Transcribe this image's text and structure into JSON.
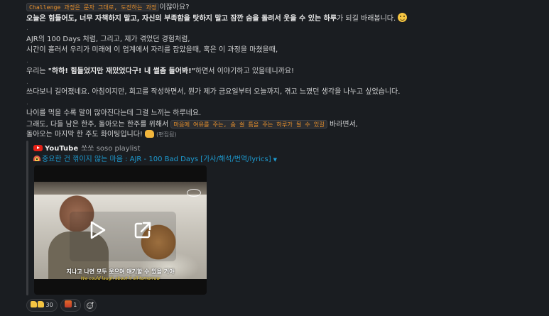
{
  "message": {
    "line1_code": "Challenge 과정은 문자 그대로, 도전하는 과정",
    "line1_rest": "이잖아요?",
    "line2_bold": "오늘은 힘들어도, 너무 자책하지 말고, 자신의 부족함을 탓하지 말고 잠깐 숨을 돌려서 웃을 수 있는 하루",
    "line2_rest": "가 되길 바래봅니다.",
    "dot": ".",
    "line4": "AJR의 100 Days 처럼, 그리고, 제가 겪었던 경험처럼,",
    "line5": "시간이 흘러서 우리가 미래에 이 업계에서 자리를 잡았을때, 혹은 이 과정을 마쳤을때,",
    "line7_pre": "우리는 ",
    "line7_bold": "\"하하! 힘들었지만 재밌었다구! 내 썰좀 들어봐!\"",
    "line7_post": "하면서 이야기하고 있을테니까요!",
    "line9": "쓰다보니 길어졌네요. 아침이지만, 회고를 작성하면서, 뭔가 제가 금요일부터 오늘까지, 겪고 느꼈던 생각을 나누고 싶었습니다.",
    "line11": "나이를 먹을 수록 말이 많아진다는데 그걸 느끼는 하루네요.",
    "line12_pre": "그래도, 다들 남은 한주, 돌아오는 한주를 위해서 ",
    "line12_code": "마음에 여유를 주는, 숨 쉴 틈을 주는 하루가 될 수 있길",
    "line12_post": " 바라면서,",
    "line13": "돌아오는 마지막 한 주도 화이팅입니다!",
    "edited": "(편집됨)"
  },
  "attachment": {
    "service": "YouTube",
    "author": "쏘쏘 soso playlist",
    "title": "중요한 건 꺾이지 않는 마음 : AJR - 100 Bad Days [가사/해석/번역/lyrics]",
    "subtitle_ko": "지나고 나면 모두 웃으며 얘기할 수 있을 거야",
    "subtitle_en": "We could laugh about it all tomorrow"
  },
  "reactions": [
    {
      "emoji": "thumbs-up",
      "count": "30"
    },
    {
      "emoji": "fire",
      "count": "1"
    }
  ],
  "colors": {
    "background": "#1a1d21",
    "link": "#1d9bd1",
    "code_text": "#e8912d",
    "youtube_red": "#e62117"
  }
}
